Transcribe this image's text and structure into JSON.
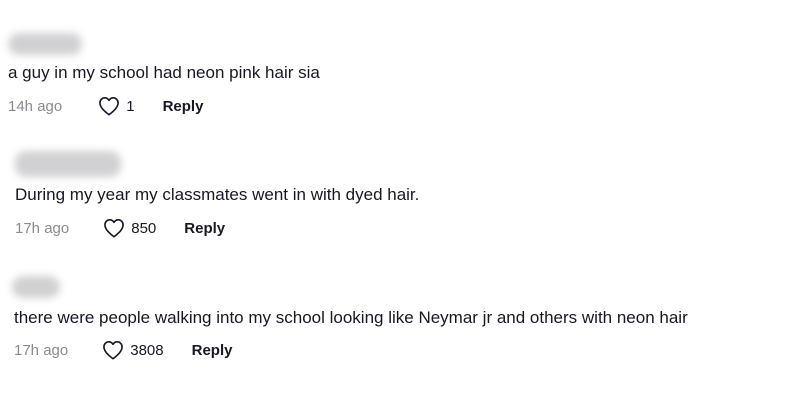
{
  "comments": [
    {
      "text": "a guy in my school had neon pink hair sia",
      "time": "14h ago",
      "likes": "1",
      "reply_label": "Reply"
    },
    {
      "text": "During my year my classmates went in with dyed hair.",
      "time": "17h ago",
      "likes": "850",
      "reply_label": "Reply"
    },
    {
      "text": "there were people walking into my school looking like Neymar jr and others with neon hair",
      "time": "17h ago",
      "likes": "3808",
      "reply_label": "Reply"
    }
  ],
  "icons": {
    "like": "heart-outline-icon"
  }
}
